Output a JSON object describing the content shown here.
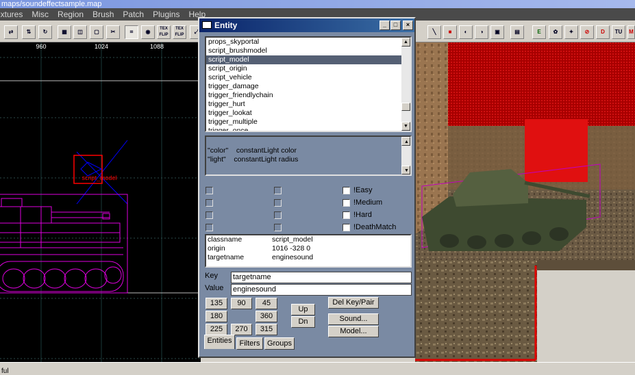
{
  "window": {
    "title": "maps/soundeffectsample.map"
  },
  "menu": [
    "Textures",
    "Misc",
    "Region",
    "Brush",
    "Patch",
    "Plugins",
    "Help"
  ],
  "grid": {
    "ruler": [
      "960",
      "1024",
      "1088"
    ],
    "entity_label": "script_model",
    "colors": {
      "background": "#000000",
      "grid": "#1a3a3a",
      "tank": "#e000e0",
      "selection": "#ff0000",
      "axis": "#0000ff"
    }
  },
  "entity": {
    "title": "Entity",
    "classes": [
      "props_skyportal",
      "script_brushmodel",
      "script_model",
      "script_origin",
      "script_vehicle",
      "trigger_damage",
      "trigger_friendlychain",
      "trigger_hurt",
      "trigger_lookat",
      "trigger_multiple",
      "trigger_once"
    ],
    "selected_class": "script_model",
    "description": [
      "\"color\"    constantLight color",
      "\"light\"    constantLight radius"
    ],
    "spawnflags": [
      "",
      "",
      "",
      "",
      "",
      "",
      "",
      "",
      "!Easy",
      "!Medium",
      "!Hard",
      "!DeathMatch"
    ],
    "properties": [
      {
        "key": "classname",
        "value": "script_model"
      },
      {
        "key": "origin",
        "value": "1016 -328 0"
      },
      {
        "key": "targetname",
        "value": "enginesound"
      }
    ],
    "key_label": "Key",
    "key_value": "targetname",
    "value_label": "Value",
    "value_value": "enginesound",
    "angles": [
      "135",
      "90",
      "45",
      "180",
      "360",
      "225",
      "270",
      "315"
    ],
    "up_label": "Up",
    "dn_label": "Dn",
    "del_label": "Del Key/Pair",
    "sound_label": "Sound...",
    "model_label": "Model...",
    "tabs": [
      "Entities",
      "Filters",
      "Groups"
    ],
    "active_tab": "Entities",
    "colors": {
      "panel": "#7a8aa3",
      "selection": "#556074",
      "title": "#0a246a"
    }
  },
  "toolbar_icons": [
    "flip-x-icon",
    "flip-y-icon",
    "rotate-icon",
    "csg-subtract-icon",
    "csg-merge-icon",
    "hollow-icon",
    "clipper-icon",
    "texture-lock-icon",
    "camera-icon",
    "scale-icon",
    "entity-icon",
    "eye-icon",
    "no-draw-icon",
    "detail-icon",
    "texture-icon",
    "color-icon",
    "hint-icon",
    "caulk-icon"
  ],
  "toolbar_marks": [
    "TEX FLIP",
    "TEX FLIP",
    "E",
    "D",
    "TU",
    "M"
  ],
  "statusbar": {
    "text": "ful"
  }
}
